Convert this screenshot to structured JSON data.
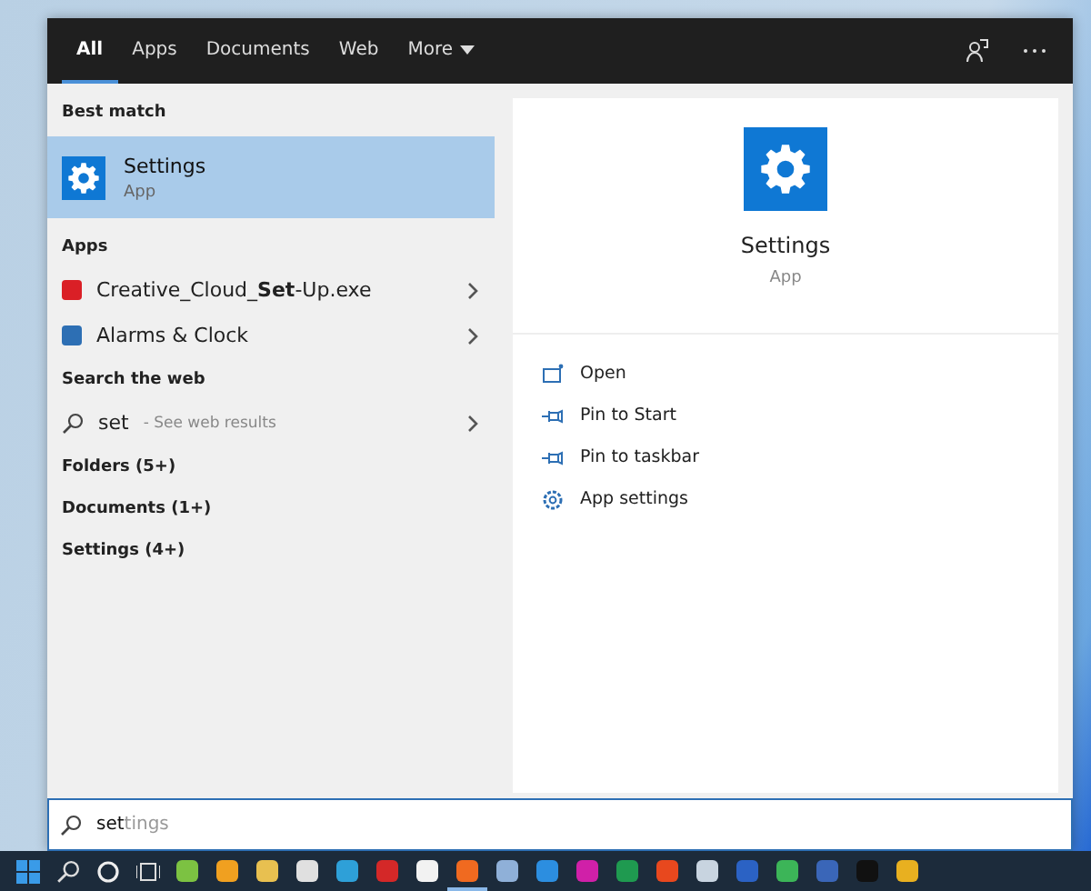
{
  "tabs": [
    {
      "label": "All",
      "selected": true,
      "caret": false
    },
    {
      "label": "Apps",
      "selected": false,
      "caret": false
    },
    {
      "label": "Documents",
      "selected": false,
      "caret": false
    },
    {
      "label": "Web",
      "selected": false,
      "caret": false
    },
    {
      "label": "More",
      "selected": false,
      "caret": true
    }
  ],
  "results": [
    {
      "kind": "heading",
      "label": "Best match"
    },
    {
      "kind": "best",
      "title": "Settings",
      "subtitle": "App",
      "selected": true
    },
    {
      "kind": "heading",
      "label": "Apps"
    },
    {
      "kind": "app",
      "label": "Creative_Cloud_**Set**-Up.exe",
      "color": "#da1f26"
    },
    {
      "kind": "app",
      "label": "Alarms & Clock",
      "color": "#2d6fb4"
    },
    {
      "kind": "heading",
      "label": "Search the web"
    },
    {
      "kind": "web",
      "query": "set",
      "hint": "- See web results"
    },
    {
      "kind": "category",
      "label": "Folders (5+)"
    },
    {
      "kind": "category",
      "label": "Documents (1+)"
    },
    {
      "kind": "category",
      "label": "Settings (4+)"
    }
  ],
  "preview": {
    "title": "Settings",
    "subtitle": "App",
    "actions": [
      {
        "kind": "open",
        "label": "Open"
      },
      {
        "kind": "pin",
        "label": "Pin to Start"
      },
      {
        "kind": "pin",
        "label": "Pin to taskbar"
      },
      {
        "kind": "gear",
        "label": "App settings"
      }
    ]
  },
  "search": {
    "typed": "set",
    "completion": "tings"
  },
  "taskbar": {
    "apps": [
      {
        "color": "#7cc242",
        "running": false
      },
      {
        "color": "#f0a020",
        "running": false
      },
      {
        "color": "#e8c050",
        "running": false
      },
      {
        "color": "#e0e0e0",
        "running": false
      },
      {
        "color": "#2ea0d8",
        "running": false
      },
      {
        "color": "#d42828",
        "running": false
      },
      {
        "color": "#f2f2f2",
        "running": false
      },
      {
        "color": "#f06a20",
        "running": true
      },
      {
        "color": "#8fb0d8",
        "running": false
      },
      {
        "color": "#2c8ee0",
        "running": false
      },
      {
        "color": "#d020a8",
        "running": false
      },
      {
        "color": "#1f9a50",
        "running": false
      },
      {
        "color": "#e8481e",
        "running": false
      },
      {
        "color": "#c8d4e0",
        "running": false
      },
      {
        "color": "#2b62c4",
        "running": false
      },
      {
        "color": "#3cb558",
        "running": false
      },
      {
        "color": "#3a66b8",
        "running": false
      },
      {
        "color": "#111111",
        "running": false
      },
      {
        "color": "#e8b020",
        "running": false
      }
    ]
  }
}
